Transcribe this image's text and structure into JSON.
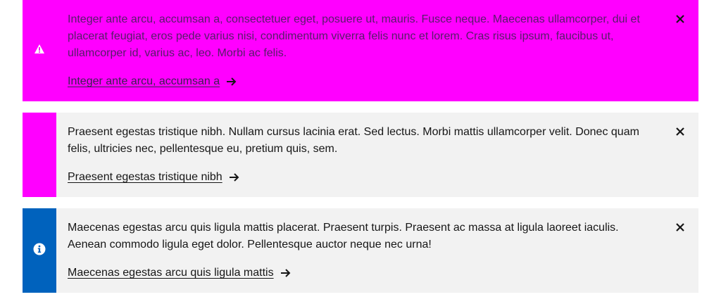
{
  "notifications": [
    {
      "kind": "warning",
      "icon": "warning-icon",
      "accent_color": "#ff00ff",
      "background_color": "#ff00ff",
      "message": "Integer ante arcu, accumsan a, consectetuer eget, posuere ut, mauris. Fusce neque. Maecenas ullamcorper, dui et placerat feugiat, eros pede varius nisi, condimentum viverra felis nunc et lorem. Cras risus ipsum, faucibus ut, ullamcorper id, varius ac, leo. Morbi ac felis.",
      "link_label": "Integer ante arcu, accumsan a"
    },
    {
      "kind": "neutral",
      "icon": "",
      "accent_color": "#ff00ff",
      "background_color": "#f2f2f2",
      "message": "Praesent egestas tristique nibh. Nullam cursus lacinia erat. Sed lectus. Morbi mattis ullamcorper velit. Donec quam felis, ultricies nec, pellentesque eu, pretium quis, sem.",
      "link_label": "Praesent egestas tristique nibh"
    },
    {
      "kind": "info",
      "icon": "info-icon",
      "accent_color": "#0062bd",
      "background_color": "#f2f2f2",
      "message": "Maecenas egestas arcu quis ligula mattis placerat. Praesent turpis. Praesent ac massa at ligula laoreet iaculis. Aenean commodo ligula eget dolor. Pellentesque auctor neque nec urna!",
      "link_label": "Maecenas egestas arcu quis ligula mattis"
    }
  ]
}
